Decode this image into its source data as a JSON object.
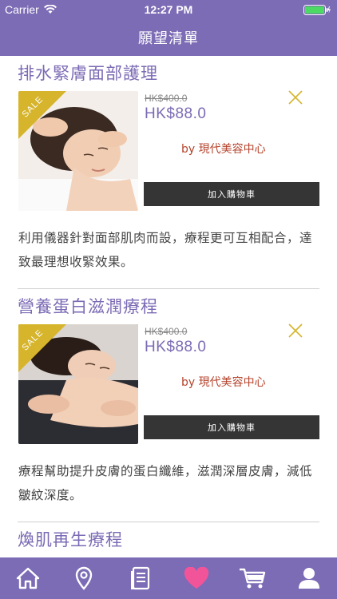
{
  "status": {
    "carrier": "Carrier",
    "time": "12:27 PM"
  },
  "header": {
    "title": "願望清單"
  },
  "items": [
    {
      "title": "排水緊膚面部護理",
      "badge": "SALE",
      "old_price": "HK$400.0",
      "price": "HK$88.0",
      "vendor": "by 現代美容中心",
      "cart_label": "加入購物車",
      "description": "利用儀器針對面部肌肉而設，療程更可互相配合，達致最理想收緊效果。"
    },
    {
      "title": "營養蛋白滋潤療程",
      "badge": "SALE",
      "old_price": "HK$400.0",
      "price": "HK$88.0",
      "vendor": "by 現代美容中心",
      "cart_label": "加入購物車",
      "description": "療程幫助提升皮膚的蛋白纖維，滋潤深層皮膚，減低皺紋深度。"
    },
    {
      "title": "煥肌再生療程"
    }
  ],
  "tabs": [
    {
      "icon": "home-icon"
    },
    {
      "icon": "location-pin-icon"
    },
    {
      "icon": "document-icon"
    },
    {
      "icon": "heart-icon",
      "active": true
    },
    {
      "icon": "cart-icon"
    },
    {
      "icon": "user-icon"
    }
  ],
  "colors": {
    "brand": "#7c6bb5",
    "active_tab": "#f2549a",
    "sale": "#d6b42b",
    "vendor": "#b5432c",
    "button": "#353535"
  }
}
